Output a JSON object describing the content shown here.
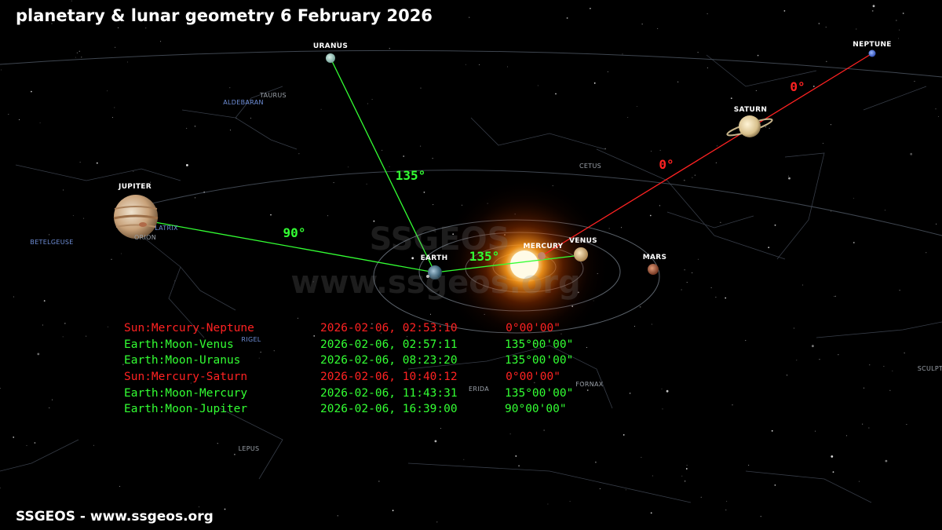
{
  "title": "planetary & lunar geometry 6 February 2026",
  "footer": "SSGEOS - www.ssgeos.org",
  "watermark": {
    "line1": "SSGEOS",
    "line2": "www.ssgeos.org"
  },
  "planets": {
    "neptune": "NEPTUNE",
    "uranus": "URANUS",
    "saturn": "SATURN",
    "jupiter": "JUPITER",
    "earth": "EARTH",
    "mercury": "MERCURY",
    "venus": "VENUS",
    "mars": "MARS"
  },
  "constellations": {
    "taurus": "TAURUS",
    "cetus": "CETUS",
    "orion": "ORION",
    "fornax": "FORNAX",
    "lepus": "LEPUS",
    "eridanus": "ERIDA",
    "sculptor": "SCULPT"
  },
  "stars": {
    "aldebaran": "ALDEBARAN",
    "betelgeuse": "BETELGEUSE",
    "bellatrix": "LATRIX",
    "rigel": "RIGEL"
  },
  "angles": {
    "uranus_line": "135°",
    "jupiter_line": "90°",
    "mercury_line": "135°",
    "neptune_line": "0°",
    "saturn_line": "0°"
  },
  "colors": {
    "aspect_green": "#33ff33",
    "aspect_red": "#ff2222",
    "sun": "#fff7cf"
  },
  "events": [
    {
      "name": "Sun:Mercury-Neptune",
      "datetime": "2026-02-06, 02:53:10",
      "angle": "0°00'00\"",
      "color": "#ff2222"
    },
    {
      "name": "Earth:Moon-Venus",
      "datetime": "2026-02-06, 02:57:11",
      "angle": "135°00'00\"",
      "color": "#33ff33"
    },
    {
      "name": "Earth:Moon-Uranus",
      "datetime": "2026-02-06, 08:23:20",
      "angle": "135°00'00\"",
      "color": "#33ff33"
    },
    {
      "name": "Sun:Mercury-Saturn",
      "datetime": "2026-02-06, 10:40:12",
      "angle": "0°00'00\"",
      "color": "#ff2222"
    },
    {
      "name": "Earth:Moon-Mercury",
      "datetime": "2026-02-06, 11:43:31",
      "angle": "135°00'00\"",
      "color": "#33ff33"
    },
    {
      "name": "Earth:Moon-Jupiter",
      "datetime": "2026-02-06, 16:39:00",
      "angle": "90°00'00\"",
      "color": "#33ff33"
    }
  ]
}
